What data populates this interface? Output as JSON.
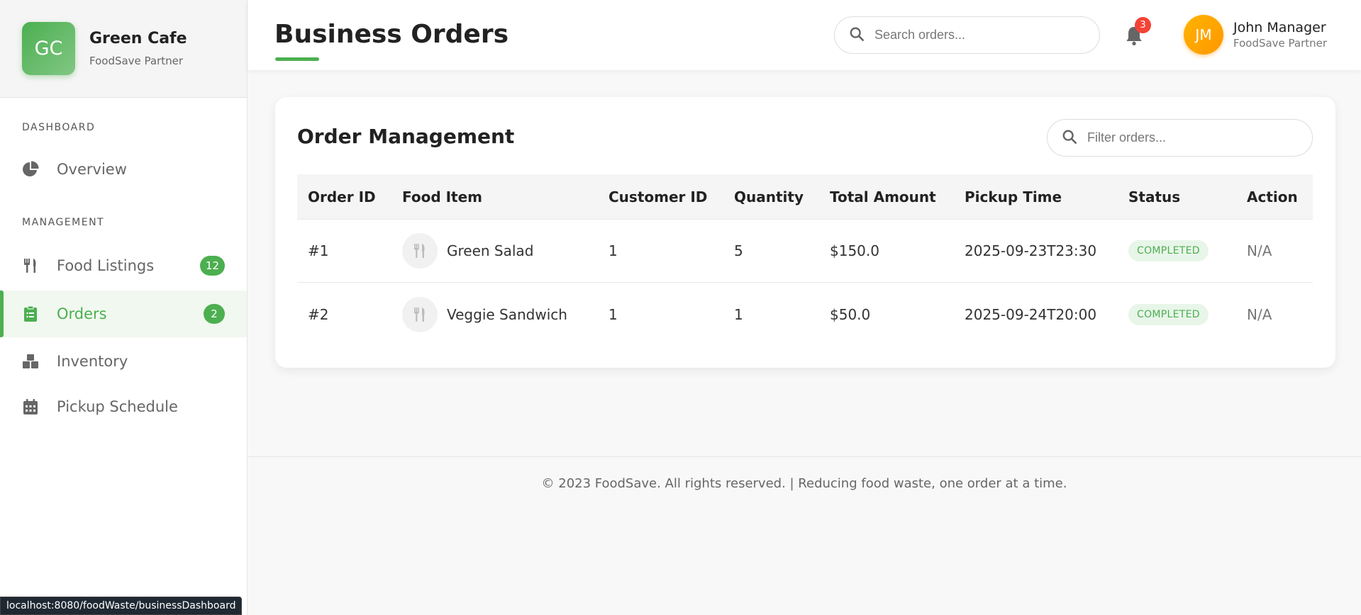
{
  "brand": {
    "initials": "GC",
    "name": "Green Cafe",
    "subtitle": "FoodSave Partner"
  },
  "sidebar": {
    "sections": [
      {
        "label": "DASHBOARD"
      },
      {
        "label": "MANAGEMENT"
      }
    ],
    "items": [
      {
        "label": "Overview",
        "icon": "pie-chart-icon"
      },
      {
        "label": "Food Listings",
        "icon": "utensils-icon",
        "badge": "12"
      },
      {
        "label": "Orders",
        "icon": "clipboard-list-icon",
        "badge": "2",
        "active": true
      },
      {
        "label": "Inventory",
        "icon": "boxes-icon"
      },
      {
        "label": "Pickup Schedule",
        "icon": "calendar-icon"
      }
    ]
  },
  "header": {
    "title": "Business Orders",
    "search_placeholder": "Search orders...",
    "notification_count": "3",
    "user": {
      "initials": "JM",
      "name": "John Manager",
      "role": "FoodSave Partner"
    }
  },
  "card": {
    "title": "Order Management",
    "filter_placeholder": "Filter orders...",
    "columns": [
      "Order ID",
      "Food Item",
      "Customer ID",
      "Quantity",
      "Total Amount",
      "Pickup Time",
      "Status",
      "Action"
    ],
    "rows": [
      {
        "order_id": "#1",
        "food_item": "Green Salad",
        "customer_id": "1",
        "quantity": "5",
        "total": "$150.0",
        "pickup": "2025-09-23T23:30",
        "status": "COMPLETED",
        "action": "N/A"
      },
      {
        "order_id": "#2",
        "food_item": "Veggie Sandwich",
        "customer_id": "1",
        "quantity": "1",
        "total": "$50.0",
        "pickup": "2025-09-24T20:00",
        "status": "COMPLETED",
        "action": "N/A"
      }
    ]
  },
  "footer": {
    "text": "© 2023 FoodSave. All rights reserved. | Reducing food waste, one order at a time."
  },
  "status_bar": {
    "url": "localhost:8080/foodWaste/businessDashboard"
  },
  "colors": {
    "accent": "#4caf50",
    "avatar": "#ff9800",
    "notification": "#f44336"
  }
}
